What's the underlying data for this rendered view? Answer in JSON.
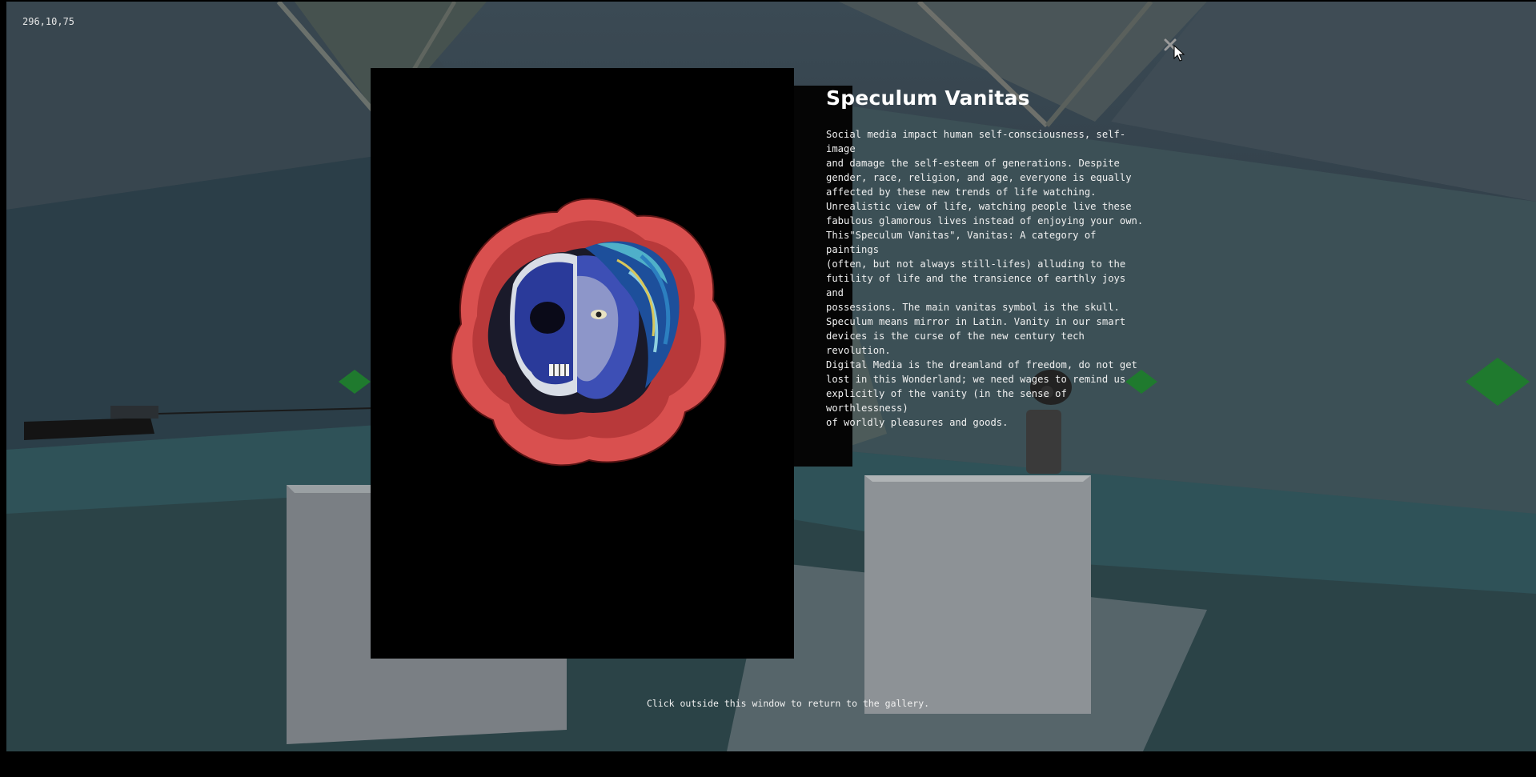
{
  "hud": {
    "coordinates": "296,10,75"
  },
  "artwork": {
    "title": "Speculum Vanitas",
    "description": "Social media impact human self-consciousness, self-image\nand damage the self-esteem of generations. Despite\ngender, race, religion, and age, everyone is equally\naffected by these new trends of life watching.\nUnrealistic view of life, watching people live these\nfabulous glamorous lives instead of enjoying your own.\nThis\"Speculum Vanitas\", Vanitas: A category of paintings\n(often, but not always still-lifes) alluding to the\nfutility of life and the transience of earthly joys and\npossessions. The main vanitas symbol is the skull.\nSpeculum means mirror in Latin. Vanity in our smart\ndevices is the curse of the new century tech revolution.\nDigital Media is the dreamland of freedom, do not get\nlost in this Wonderland; we need wages to remind us\nexplicitly of the vanity (in the sense of worthlessness)\nof worldly pleasures and goods."
  },
  "modal": {
    "close_icon": "close-icon",
    "return_hint": "Click outside this window to return to the gallery."
  },
  "colors": {
    "scene_dark": "#2f3d47",
    "rose_red": "#d9504f",
    "accent_green": "#1f7a2e"
  }
}
